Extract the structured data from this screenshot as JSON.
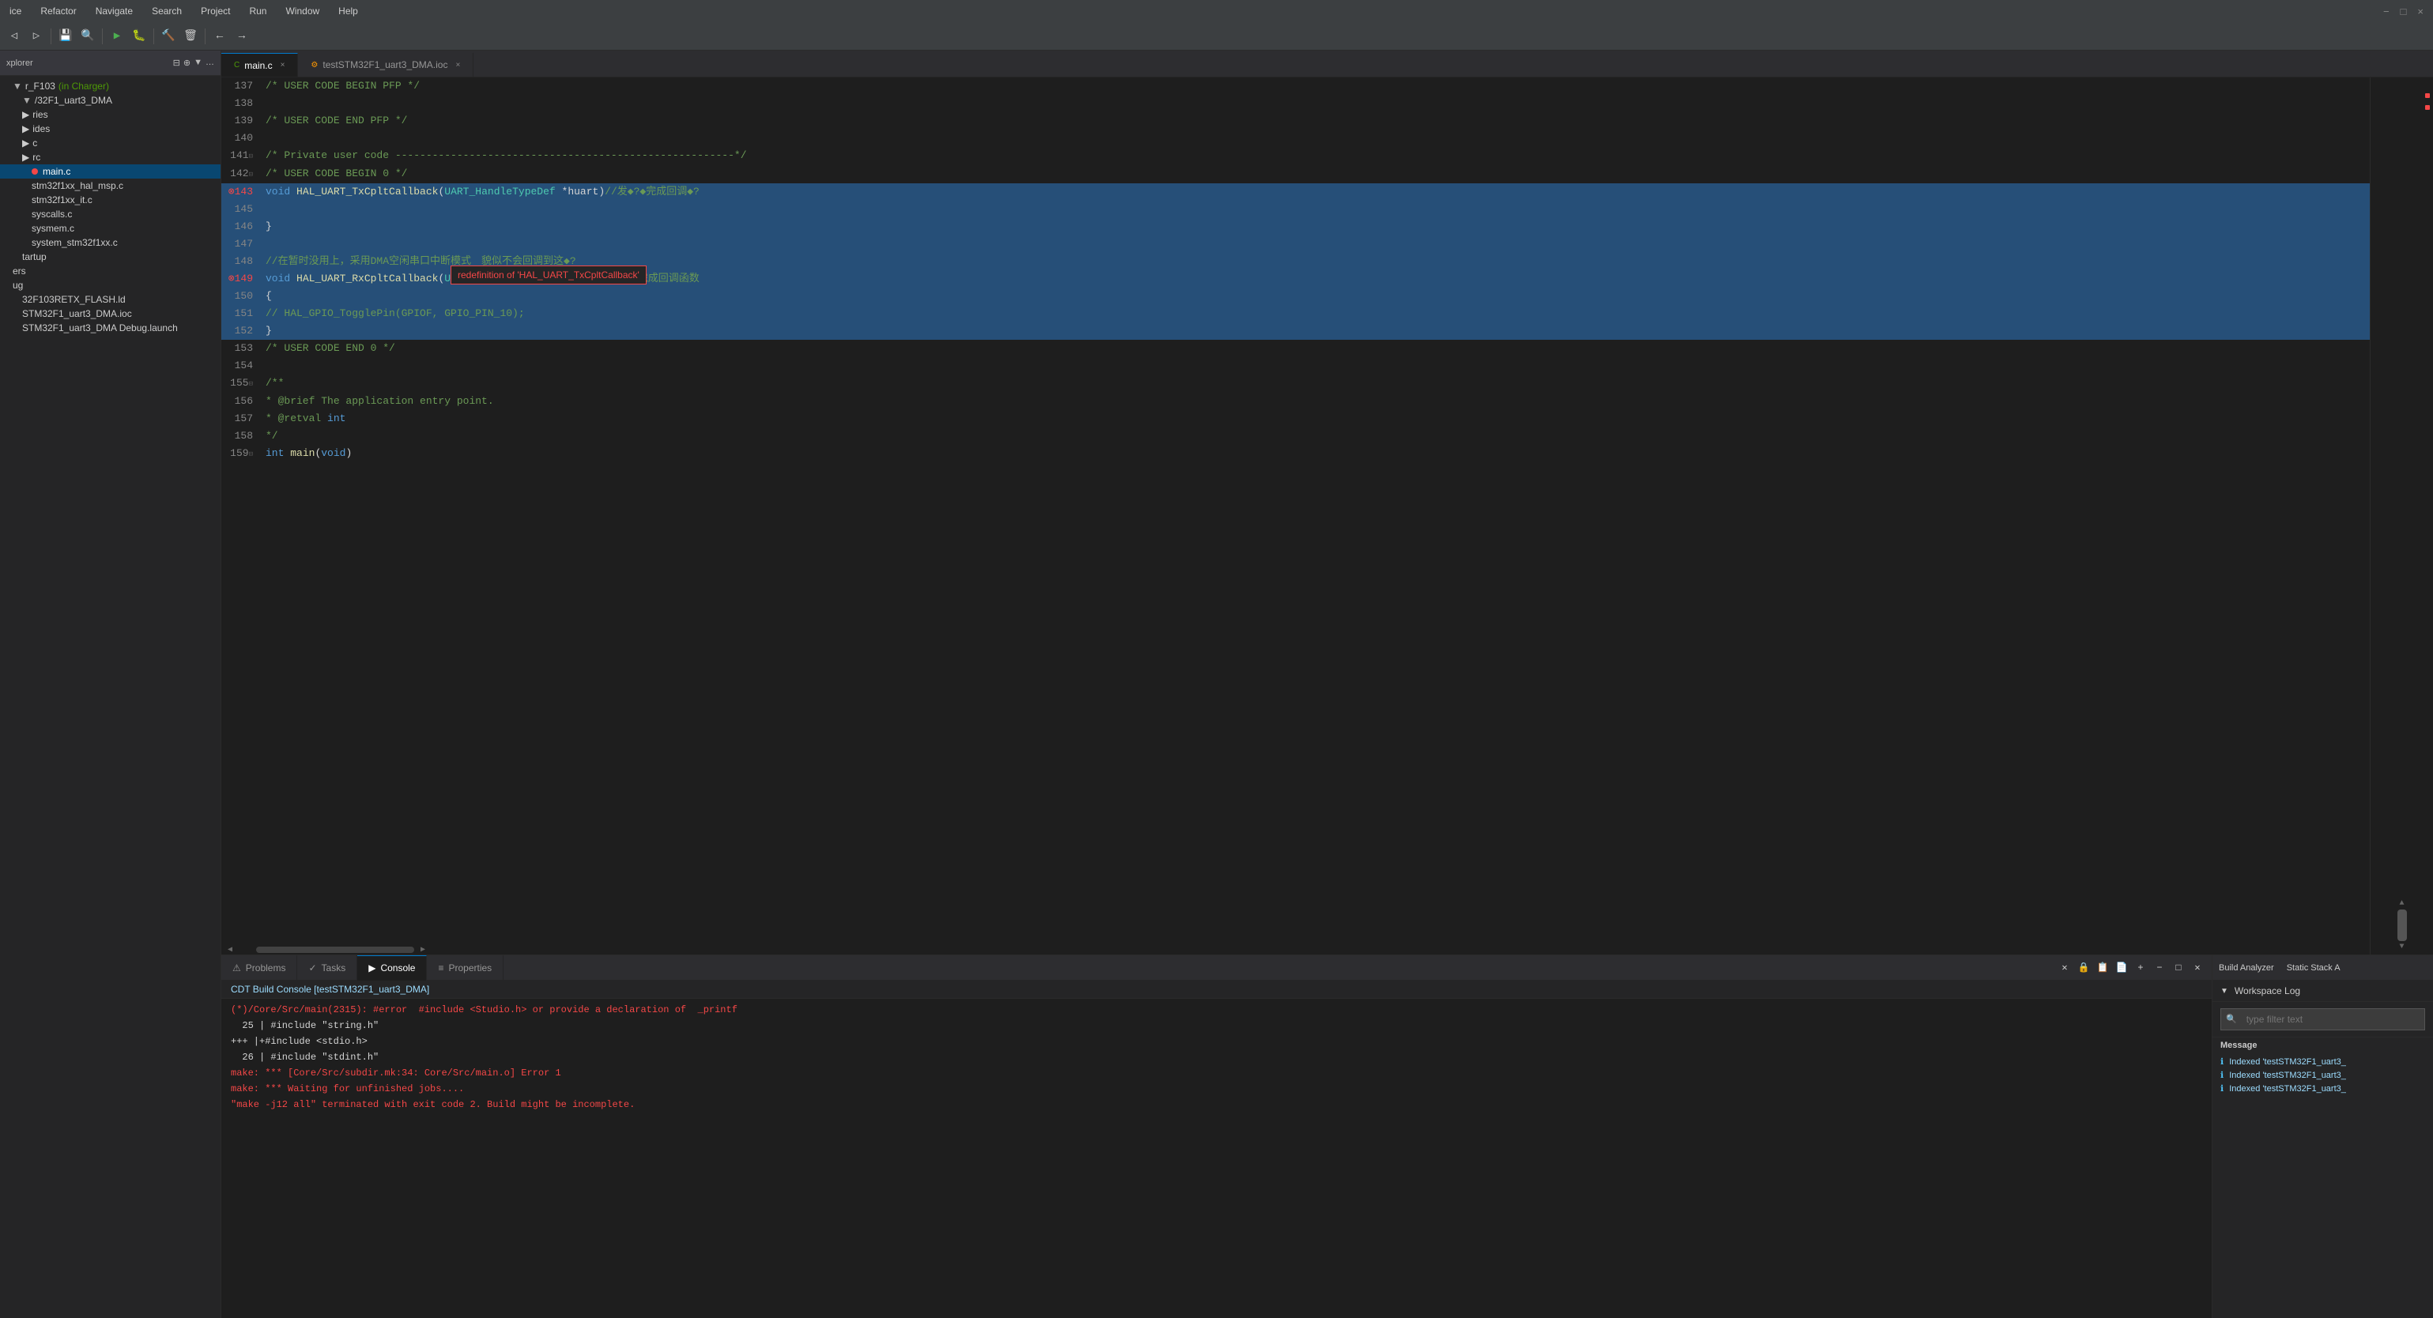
{
  "menuBar": {
    "items": [
      "ice",
      "Refactor",
      "Navigate",
      "Search",
      "Project",
      "Run",
      "Window",
      "Help"
    ]
  },
  "sidebar": {
    "title": "xplorer",
    "projectName": "r_F103",
    "projectLabel": "(in Charger)",
    "items": [
      {
        "label": "/32F1_uart3_DMA",
        "indent": 0
      },
      {
        "label": "ries",
        "indent": 0
      },
      {
        "label": "ides",
        "indent": 0
      },
      {
        "label": "c",
        "indent": 0
      },
      {
        "label": "rc",
        "indent": 0
      },
      {
        "label": "main.c",
        "indent": 1,
        "hasError": true,
        "active": true
      },
      {
        "label": "stm32f1xx_hal_msp.c",
        "indent": 1
      },
      {
        "label": "stm32f1xx_it.c",
        "indent": 1
      },
      {
        "label": "syscalls.c",
        "indent": 1
      },
      {
        "label": "sysmem.c",
        "indent": 1
      },
      {
        "label": "system_stm32f1xx.c",
        "indent": 1
      },
      {
        "label": "tartup",
        "indent": 1
      },
      {
        "label": "ers",
        "indent": 0
      },
      {
        "label": "ug",
        "indent": 0
      },
      {
        "label": "32F103RETX_FLASH.ld",
        "indent": 1
      },
      {
        "label": "STM32F1_uart3_DMA.ioc",
        "indent": 1
      },
      {
        "label": "STM32F1_uart3_DMA Debug.launch",
        "indent": 1
      }
    ]
  },
  "tabs": [
    {
      "label": "main.c",
      "active": true,
      "icon": "c"
    },
    {
      "label": "testSTM32F1_uart3_DMA.ioc",
      "active": false,
      "icon": "ioc"
    }
  ],
  "codeLines": [
    {
      "num": "137",
      "content": "/* USER CODE BEGIN PFP */",
      "type": "comment",
      "selected": false
    },
    {
      "num": "138",
      "content": "",
      "selected": false
    },
    {
      "num": "139",
      "content": "/* USER CODE END PFP */",
      "type": "comment",
      "selected": false
    },
    {
      "num": "140",
      "content": "",
      "selected": false
    },
    {
      "num": "141",
      "content": "/* Private user code -----------------------------------------------------*/",
      "type": "comment",
      "selected": false,
      "hasCollapse": true
    },
    {
      "num": "142",
      "content": "/* USER CODE BEGIN 0 */",
      "type": "comment",
      "selected": false,
      "hasCollapse": true
    },
    {
      "num": "143",
      "content": "void HAL_UART_TxCpltCallback(UART_HandleTypeDef *huart)//发？?完成回调？?",
      "selected": true,
      "hasError": true,
      "errorPos": 3
    },
    {
      "num": "144",
      "content": "redefinition of 'HAL_UART_TxCpltCallback'",
      "isTooltip": true
    },
    {
      "num": "145",
      "content": "",
      "selected": true
    },
    {
      "num": "146",
      "content": "}",
      "selected": true
    },
    {
      "num": "147",
      "content": "",
      "selected": true
    },
    {
      "num": "148",
      "content": "//在暂时没用上，采用DMA空闲串口中断模式　貌似不会回调到这？?",
      "selected": true,
      "type": "comment"
    },
    {
      "num": "149",
      "content": "void HAL_UART_RxCpltCallback(UART_HandleTypeDef *huart)//接收完成回调函数",
      "selected": true,
      "hasError": true,
      "errorPos": 3
    },
    {
      "num": "150",
      "content": "{",
      "selected": true
    },
    {
      "num": "151",
      "content": "    //  HAL_GPIO_TogglePin(GPIOF, GPIO_PIN_10);",
      "selected": true,
      "type": "comment"
    },
    {
      "num": "152",
      "content": "}",
      "selected": true
    },
    {
      "num": "153",
      "content": "/* USER CODE END 0 */",
      "type": "comment",
      "selected": false
    },
    {
      "num": "154",
      "content": "",
      "selected": false
    },
    {
      "num": "155",
      "content": "/**",
      "type": "comment",
      "selected": false,
      "hasCollapse": true
    },
    {
      "num": "156",
      "content": "  * @brief  The application entry point.",
      "type": "comment",
      "selected": false
    },
    {
      "num": "157",
      "content": "  * @retval int",
      "type": "comment",
      "selected": false
    },
    {
      "num": "158",
      "content": "  */",
      "type": "comment",
      "selected": false
    },
    {
      "num": "159",
      "content": "int main(void)",
      "selected": false,
      "hasCollapse": true,
      "isMain": true
    }
  ],
  "errorTooltip": "redefinition of 'HAL_UART_TxCpltCallback'",
  "bottomPanel": {
    "tabs": [
      {
        "label": "Problems",
        "icon": "⚠",
        "active": false
      },
      {
        "label": "Tasks",
        "icon": "✓",
        "active": false
      },
      {
        "label": "Console",
        "icon": "▶",
        "active": true
      },
      {
        "label": "Properties",
        "icon": "≡",
        "active": false
      }
    ],
    "consoleTitle": "CDT Build Console [testSTM32F1_uart3_DMA]",
    "consoleLines": [
      {
        "text": "(*)Core/Src/main(2315): #error #include <Studio.h> or provide a declaration of _printf",
        "type": "error"
      },
      {
        "text": "  25 | #include \"string.h\"",
        "type": "normal"
      },
      {
        "text": "+++ |+#include <stdio.h>",
        "type": "normal"
      },
      {
        "text": "  26 | #include \"stdint.h\"",
        "type": "normal"
      },
      {
        "text": "make: *** [Core/Src/subdir.mk:34: Core/Src/main.o] Error 1",
        "type": "error"
      },
      {
        "text": "make: *** Waiting for unfinished jobs....",
        "type": "error"
      },
      {
        "text": "\"make -j12 all\" terminated with exit code 2. Build might be incomplete.",
        "type": "error"
      }
    ]
  },
  "rightPanel": {
    "buildAnalyzer": "Build Analyzer",
    "staticStackA": "Static Stack A",
    "workspaceLog": "Workspace Log",
    "filterPlaceholder": "type filter text",
    "messageLabel": "Message",
    "logItems": [
      {
        "text": "Indexed 'testSTM32F1_uart3_"
      },
      {
        "text": "Indexed 'testSTM32F1_uart3_"
      },
      {
        "text": "Indexed 'testSTM32F1_uart3_"
      }
    ]
  }
}
